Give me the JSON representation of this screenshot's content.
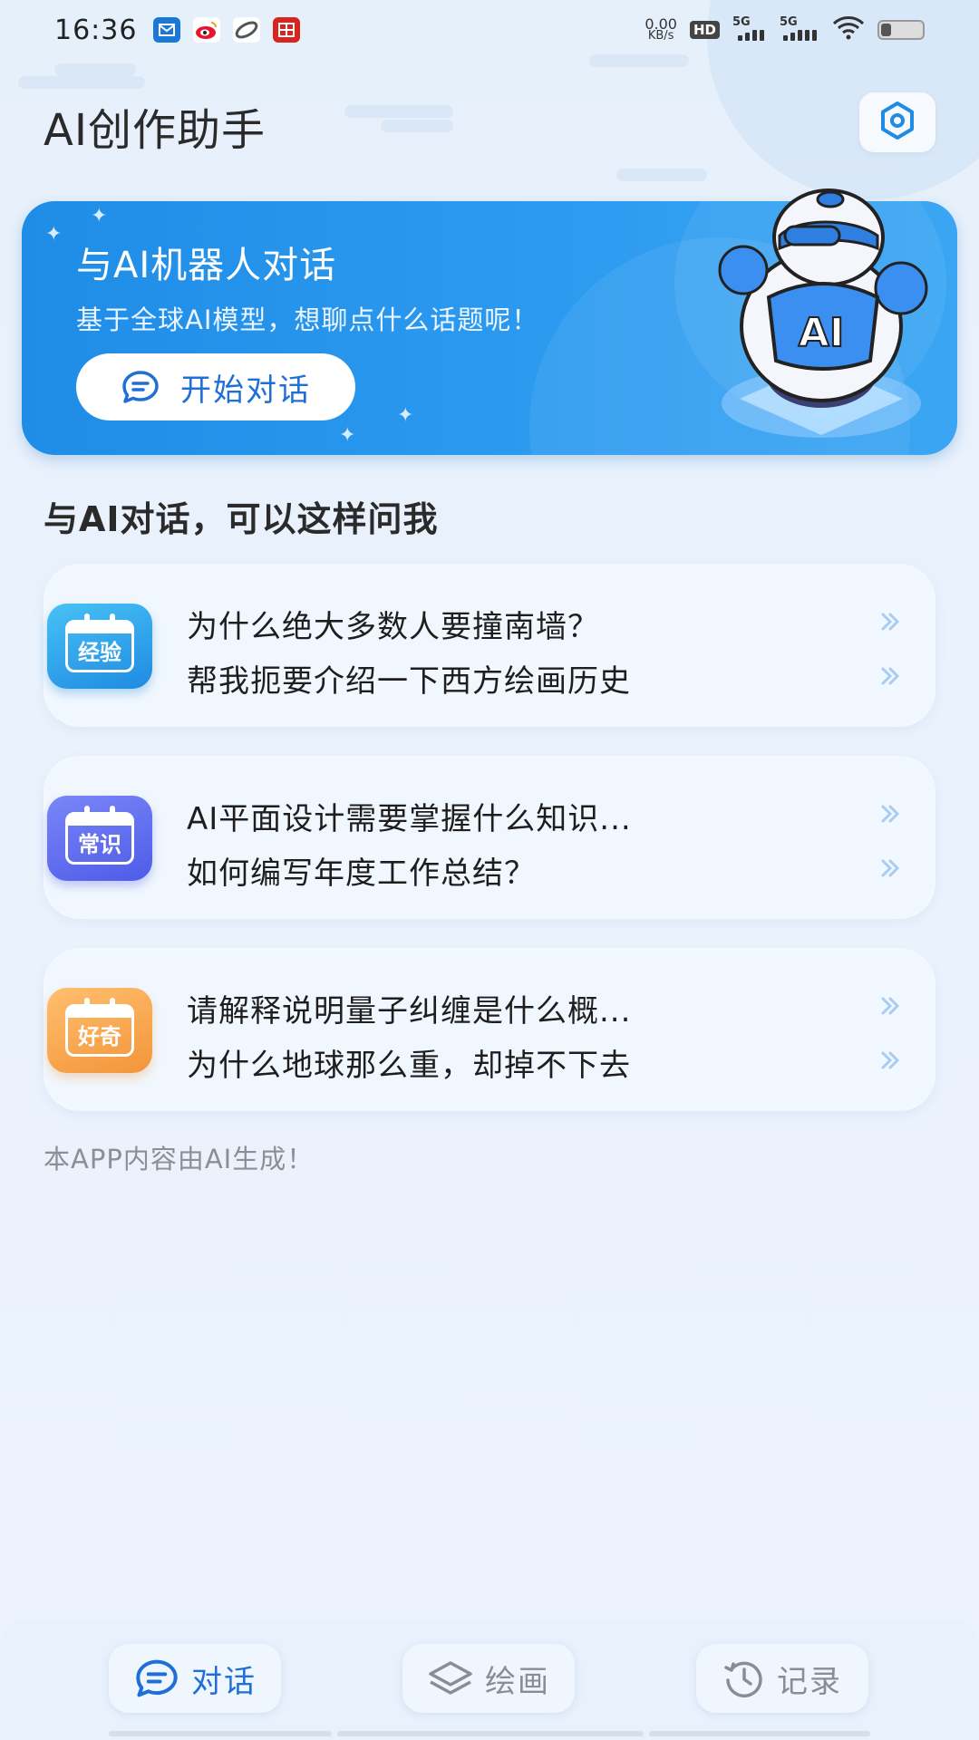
{
  "status_bar": {
    "time": "16:36",
    "net_speed_value": "0.00",
    "net_speed_unit": "KB/s",
    "hd_label": "HD",
    "sim1_label": "5G",
    "sim2_label": "5G",
    "battery_level": 0.25,
    "app_icons": [
      "email-app-icon",
      "weibo-icon",
      "orbit-app-icon",
      "citic-bank-icon"
    ]
  },
  "header": {
    "title": "AI创作助手",
    "settings_icon": "settings-hexagon-icon"
  },
  "banner": {
    "title": "与AI机器人对话",
    "subtitle": "基于全球AI模型，想聊点什么话题呢！",
    "button_label": "开始对话",
    "robot_label": "AI"
  },
  "section": {
    "title": "与AI对话，可以这样问我"
  },
  "cards": [
    {
      "badge": "经验",
      "color": "#2aa3ec",
      "questions": [
        "为什么绝大多数人要撞南墙？",
        "帮我扼要介绍一下西方绘画历史"
      ]
    },
    {
      "badge": "常识",
      "color": "#5e6cf0",
      "questions": [
        "AI平面设计需要掌握什么知识...",
        "如何编写年度工作总结？"
      ]
    },
    {
      "badge": "好奇",
      "color": "#f5a04d",
      "questions": [
        "请解释说明量子纠缠是什么概...",
        "为什么地球那么重，却掉不下去"
      ]
    }
  ],
  "footnote": "本APP内容由AI生成！",
  "bottom_nav": {
    "items": [
      {
        "label": "对话",
        "icon": "chat-icon",
        "active": true
      },
      {
        "label": "绘画",
        "icon": "layers-icon",
        "active": false
      },
      {
        "label": "记录",
        "icon": "history-icon",
        "active": false
      }
    ]
  },
  "colors": {
    "accent": "#1f6fd6",
    "banner": "#2d9bf0",
    "chevron": "#a9cdf2"
  }
}
